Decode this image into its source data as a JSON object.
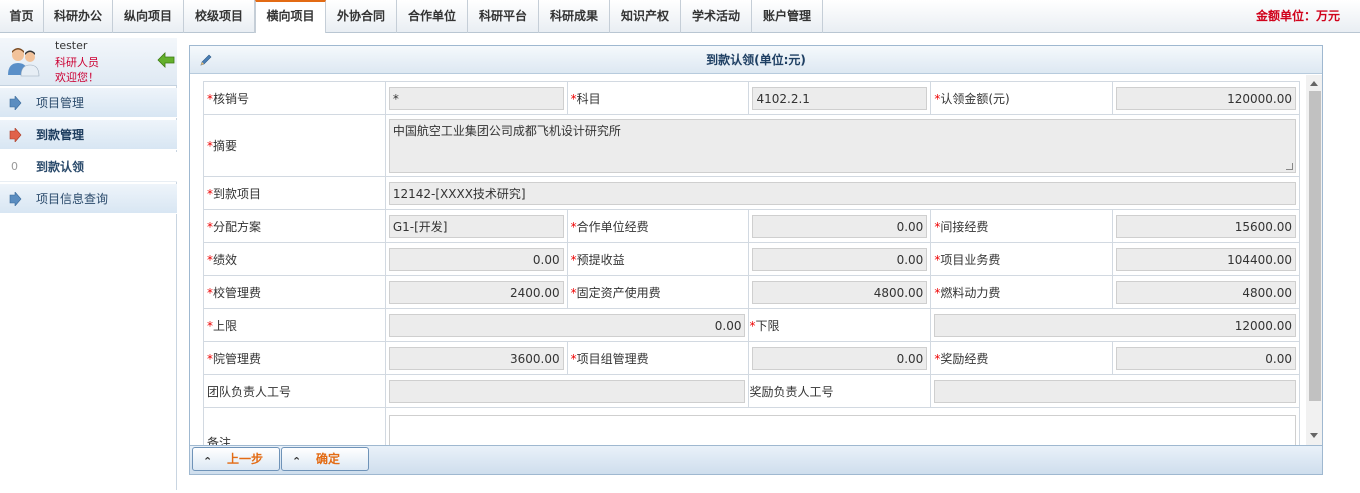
{
  "nav": {
    "tabs": [
      "首页",
      "科研办公",
      "纵向项目",
      "校级项目",
      "横向项目",
      "外协合同",
      "合作单位",
      "科研平台",
      "科研成果",
      "知识产权",
      "学术活动",
      "账户管理"
    ],
    "active_index": 4,
    "unit_text": "金额单位：万元"
  },
  "user": {
    "name": "tester",
    "role": "科研人员",
    "welcome": "欢迎您！"
  },
  "sidebar": {
    "items": [
      {
        "label": "项目管理"
      },
      {
        "label": "到款管理"
      },
      {
        "label": "到款认领"
      },
      {
        "label": "项目信息查询"
      }
    ],
    "sub_badge": "0"
  },
  "panel": {
    "title": "到款认领(单位:元)"
  },
  "form": {
    "hexiaohao_label": "核销号",
    "hexiaohao_value": "*",
    "kemu_label": "科目",
    "kemu_value": "4102.2.1",
    "renling_label": "认领金额(元)",
    "renling_value": "120000.00",
    "zhaiyao_label": "摘要",
    "zhaiyao_value": "中国航空工业集团公司成都飞机设计研究所",
    "daokuan_label": "到款项目",
    "daokuan_value": "12142-[XXXX技术研究]",
    "fenpei_label": "分配方案",
    "fenpei_value": "G1-[开发]",
    "hezuo_label": "合作单位经费",
    "hezuo_value": "0.00",
    "jianjie_label": "间接经费",
    "jianjie_value": "15600.00",
    "jixiao_label": "绩效",
    "jixiao_value": "0.00",
    "yuti_label": "预提收益",
    "yuti_value": "0.00",
    "yewu_label": "项目业务费",
    "yewu_value": "104400.00",
    "xiaoguanli_label": "校管理费",
    "xiaoguanli_value": "2400.00",
    "guding_label": "固定资产使用费",
    "guding_value": "4800.00",
    "ranliao_label": "燃料动力费",
    "ranliao_value": "4800.00",
    "shangxian_label": "上限",
    "shangxian_value": "0.00",
    "xiaxian_label": "下限",
    "xiaxian_value": "12000.00",
    "yuanguanli_label": "院管理费",
    "yuanguanli_value": "3600.00",
    "zuguanli_label": "项目组管理费",
    "zuguanli_value": "0.00",
    "jiangli_label": "奖励经费",
    "jiangli_value": "0.00",
    "tuandui_label": "团队负责人工号",
    "tuandui_value": "",
    "jiangliren_label": "奖励负责人工号",
    "jiangliren_value": "",
    "beizhu_label": "备注",
    "beizhu_value": ""
  },
  "buttons": {
    "prev_label": "上一步",
    "confirm_label": "确定"
  },
  "colors": {
    "accent": "#e36b14",
    "required": "#e00000",
    "unit_text": "#d0021b"
  },
  "icons": [
    "user-avatar-icon",
    "back-arrow-icon",
    "arrow-right-icon",
    "pencil-icon",
    "chevron-up-icon"
  ]
}
